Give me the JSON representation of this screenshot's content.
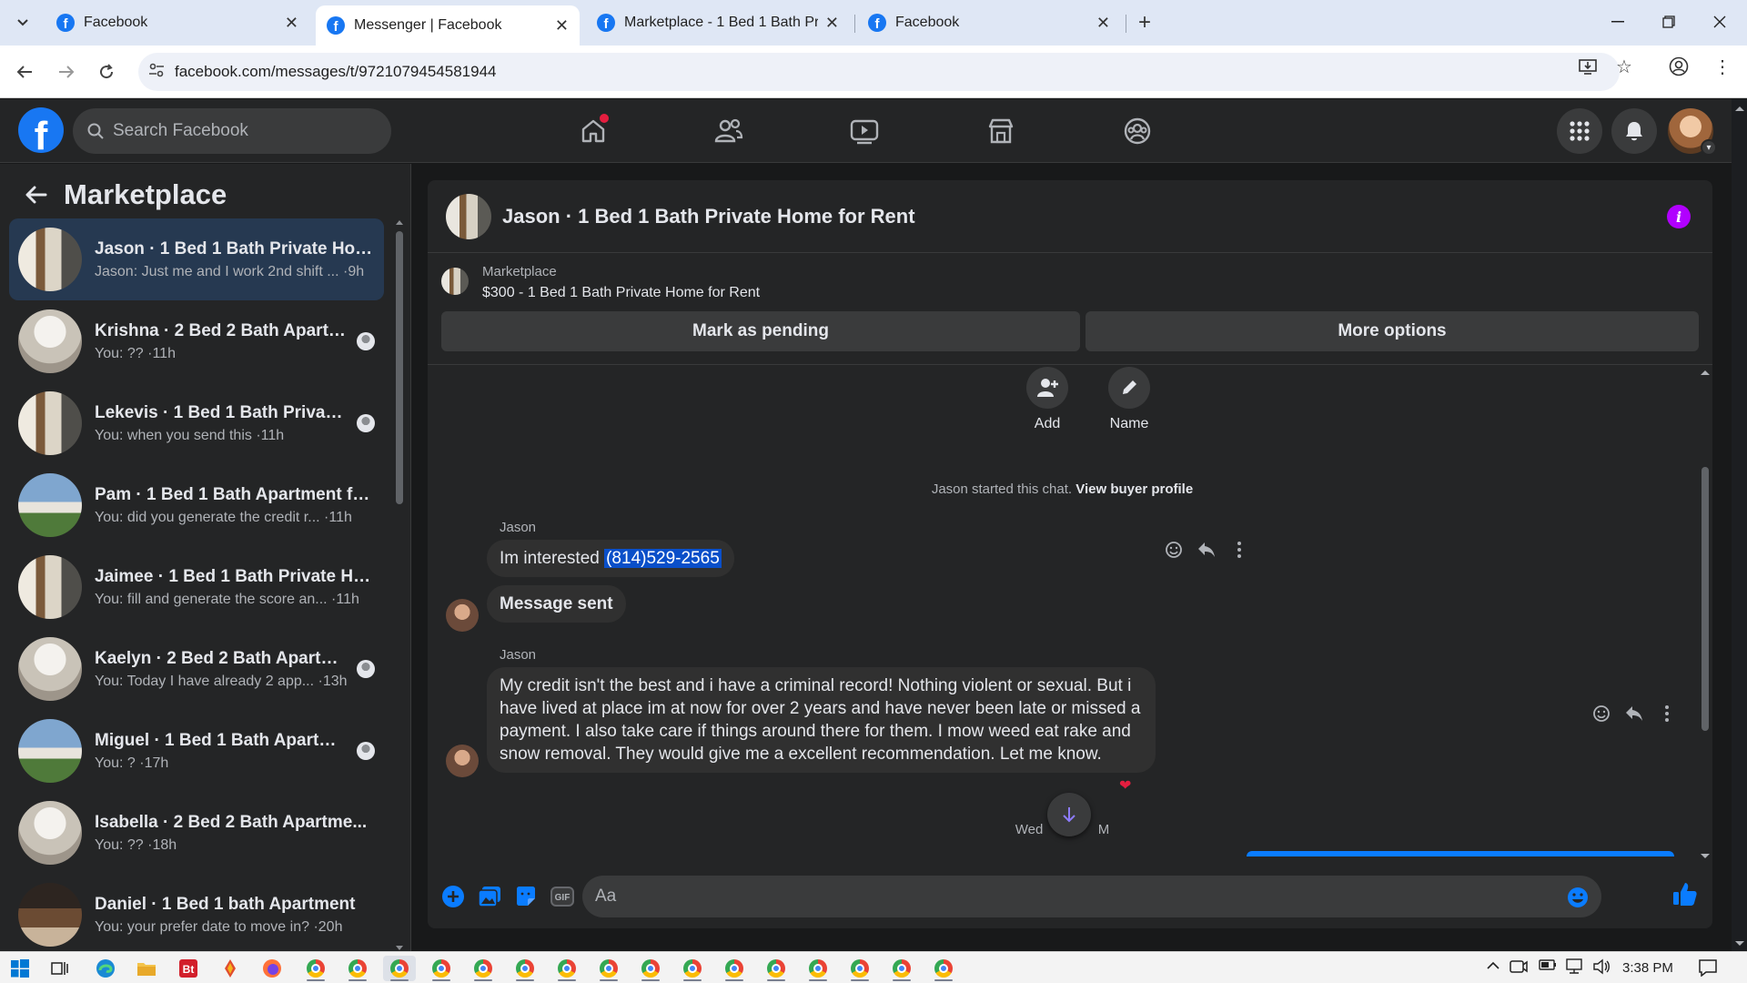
{
  "browser": {
    "tabs": [
      {
        "title": "Facebook",
        "active": false
      },
      {
        "title": "Messenger | Facebook",
        "active": true
      },
      {
        "title": "Marketplace - 1 Bed 1 Bath Priv",
        "active": false
      },
      {
        "title": "Facebook",
        "active": false
      }
    ],
    "url": "facebook.com/messages/t/9721079454581944"
  },
  "fb": {
    "search_placeholder": "Search Facebook"
  },
  "sidebar": {
    "title": "Marketplace",
    "conversations": [
      {
        "name": "Jason · 1 Bed 1 Bath Private Hom...",
        "preview": "Jason: Just me and I work 2nd shift ... ·9h",
        "active": true,
        "seen": false,
        "thumb": "interior"
      },
      {
        "name": "Krishna · 2 Bed 2 Bath Apartm...",
        "preview": "You: ?? ·11h",
        "active": false,
        "seen": true,
        "thumb": "kitchen"
      },
      {
        "name": "Lekevis · 1 Bed 1 Bath Private ...",
        "preview": "You: when you send this ·11h",
        "active": false,
        "seen": true,
        "thumb": "interior"
      },
      {
        "name": "Pam · 1 Bed 1 Bath Apartment fo...",
        "preview": "You: did you generate the credit r... ·11h",
        "active": false,
        "seen": false,
        "thumb": "house"
      },
      {
        "name": "Jaimee · 1 Bed 1 Bath Private Ho...",
        "preview": "You: fill and generate the score an... ·11h",
        "active": false,
        "seen": false,
        "thumb": "interior"
      },
      {
        "name": "Kaelyn · 2 Bed 2 Bath Apartm...",
        "preview": "You: Today I have already 2 app... ·13h",
        "active": false,
        "seen": true,
        "thumb": "kitchen"
      },
      {
        "name": "Miguel · 1 Bed 1 Bath Apartme...",
        "preview": "You: ? ·17h",
        "active": false,
        "seen": true,
        "thumb": "house"
      },
      {
        "name": "Isabella · 2 Bed 2 Bath Apartme...",
        "preview": "You: ?? ·18h",
        "active": false,
        "seen": false,
        "thumb": "kitchen"
      },
      {
        "name": "Daniel · 1 Bed 1 bath Apartment",
        "preview": "You: your prefer date to move in? ·20h",
        "active": false,
        "seen": false,
        "thumb": "dark"
      }
    ]
  },
  "chat": {
    "title": "Jason · 1 Bed 1 Bath Private Home for Rent",
    "listing_source": "Marketplace",
    "listing_desc": "$300 - 1 Bed 1 Bath Private Home for Rent",
    "pending_label": "Mark as pending",
    "more_label": "More options",
    "utils": {
      "add": "Add",
      "name": "Name"
    },
    "started_text": "Jason started this chat.",
    "buyer_link": "View buyer profile",
    "messages": [
      {
        "sender": "Jason",
        "text_before": "Im interested ",
        "highlight": "(814)529-2565"
      },
      {
        "sender": "",
        "text": "Message sent"
      },
      {
        "sender": "Jason",
        "text": "My credit isn't the best and i have a criminal record! Nothing violent or sexual.  But i have lived at place im at now for over 2 years and have never been late or missed a payment. I also take care if things around there for them. I mow weed eat rake and snow removal. They would give me a excellent recommendation.  Let me know.",
        "reaction": "❤"
      }
    ],
    "date_sep_left": "Wed",
    "date_sep_right": "M",
    "composer_placeholder": "Aa"
  },
  "taskbar": {
    "clock": "3:38 PM"
  },
  "colors": {
    "fb_blue": "#1877f2",
    "bg": "#18191a",
    "surface": "#242526",
    "selected": "#263951",
    "info": "#b100ff"
  }
}
